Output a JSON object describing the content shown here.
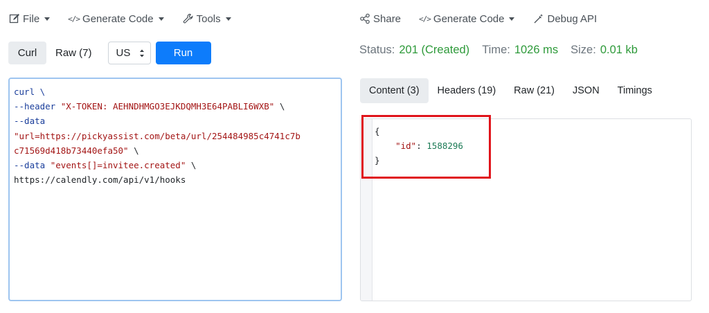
{
  "left_toolbar": {
    "file_label": "File",
    "generate_code_label": "Generate Code",
    "tools_label": "Tools"
  },
  "right_toolbar": {
    "share_label": "Share",
    "generate_code_label": "Generate Code",
    "debug_label": "Debug API"
  },
  "controls": {
    "curl_tab": "Curl",
    "raw_tab": "Raw (7)",
    "region_select": "US",
    "run_label": "Run"
  },
  "editor": {
    "lines": [
      [
        {
          "t": "curl \\",
          "c": "kw"
        }
      ],
      [
        {
          "t": "--header ",
          "c": "kw"
        },
        {
          "t": "\"X-TOKEN: AEHNDHMGO3EJKDQMH3E64PABLI6WXB\"",
          "c": "str"
        },
        {
          "t": " \\",
          "c": ""
        }
      ],
      [
        {
          "t": "--data",
          "c": "kw"
        }
      ],
      [
        {
          "t": "\"url=https://pickyassist.com/beta/url/254484985c4741c7b",
          "c": "str"
        }
      ],
      [
        {
          "t": "c71569d418b73440efa50\"",
          "c": "str"
        },
        {
          "t": " \\",
          "c": ""
        }
      ],
      [
        {
          "t": "--data ",
          "c": "kw"
        },
        {
          "t": "\"events[]=invitee.created\"",
          "c": "str"
        },
        {
          "t": " \\",
          "c": ""
        }
      ],
      [
        {
          "t": "https://calendly.com/api/v1/hooks",
          "c": ""
        }
      ]
    ]
  },
  "status": {
    "status_label": "Status:",
    "status_value": "201 (Created)",
    "time_label": "Time:",
    "time_value": "1026 ms",
    "size_label": "Size:",
    "size_value": "0.01 kb",
    "success_color": "#2e9a3a"
  },
  "response_tabs": [
    {
      "label": "Content (3)",
      "active": true
    },
    {
      "label": "Headers (19)",
      "active": false
    },
    {
      "label": "Raw (21)",
      "active": false
    },
    {
      "label": "JSON",
      "active": false
    },
    {
      "label": "Timings",
      "active": false
    }
  ],
  "response": {
    "open_brace": "{",
    "key": "\"id\"",
    "colon": ": ",
    "value": "1588296",
    "close_brace": "}"
  },
  "colors": {
    "run_button": "#0d7cfb",
    "highlight_border": "#e0141b",
    "editor_focus_border": "#9ec5f0"
  }
}
